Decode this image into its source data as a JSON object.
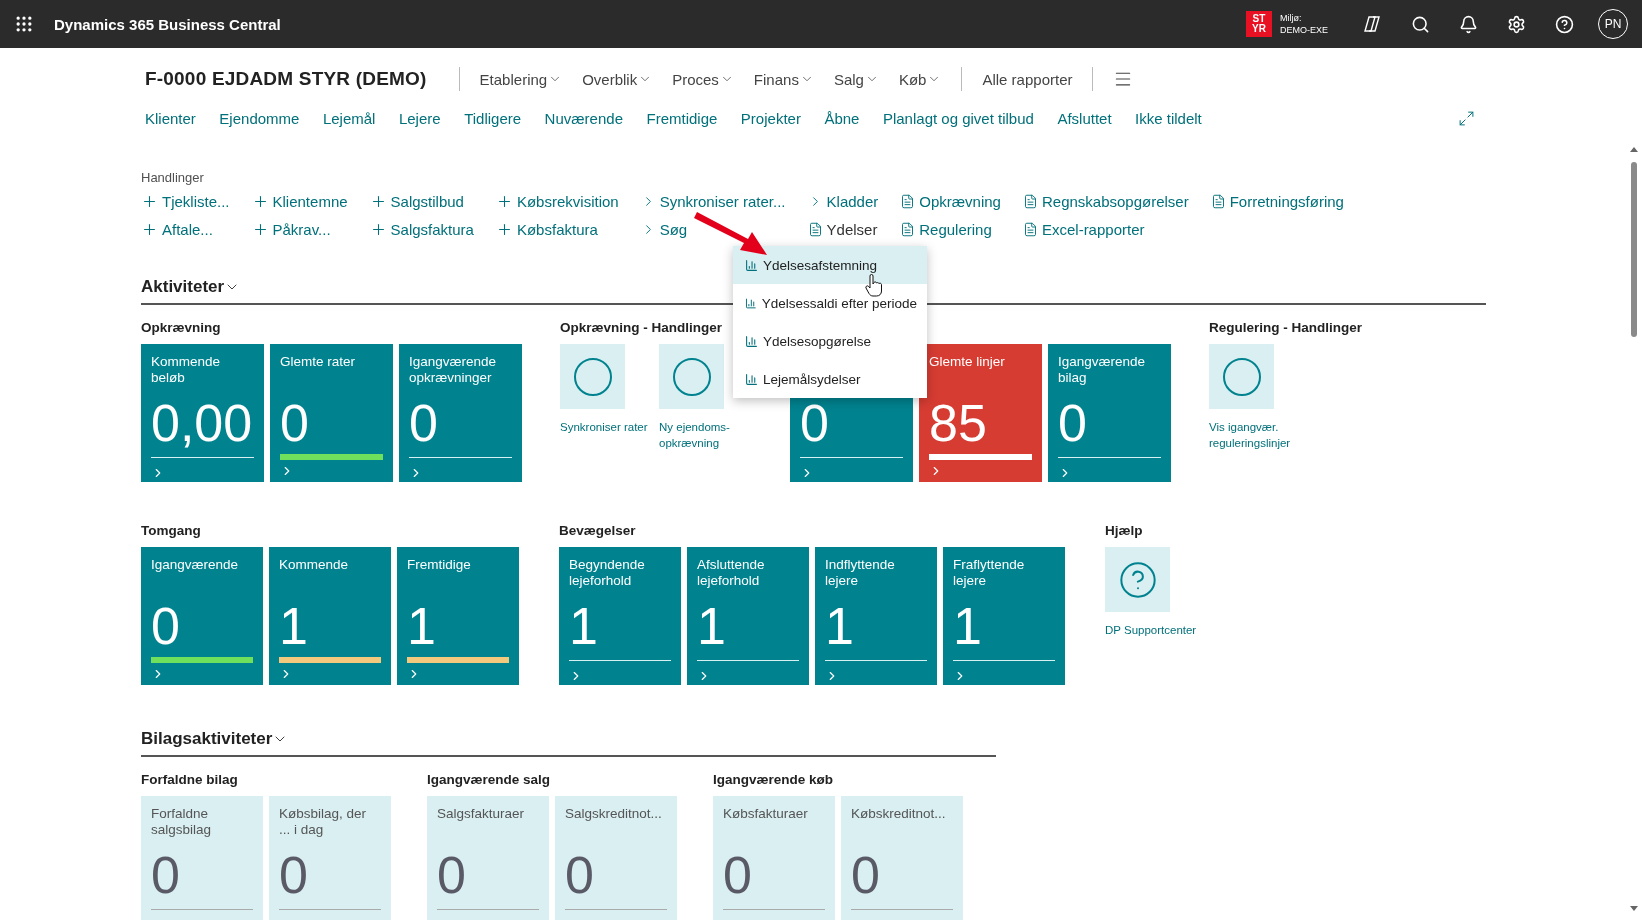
{
  "topbar": {
    "app_title": "Dynamics 365 Business Central",
    "env_badge": [
      "ST",
      "YR"
    ],
    "env_label": "Miljø:",
    "env_name": "DEMO-EXE",
    "avatar": "PN"
  },
  "header": {
    "company": "F-0000 EJDADM STYR (DEMO)",
    "menus": [
      {
        "label": "Etablering",
        "dropdown": true
      },
      {
        "label": "Overblik",
        "dropdown": true
      },
      {
        "label": "Proces",
        "dropdown": true
      },
      {
        "label": "Finans",
        "dropdown": true
      },
      {
        "label": "Salg",
        "dropdown": true
      },
      {
        "label": "Køb",
        "dropdown": true
      },
      {
        "label": "Alle rapporter",
        "dropdown": false
      }
    ],
    "links": [
      "Klienter",
      "Ejendomme",
      "Lejemål",
      "Lejere",
      "Tidligere",
      "Nuværende",
      "Fremtidige",
      "Projekter",
      "Åbne",
      "Planlagt og givet tilbud",
      "Afsluttet",
      "Ikke tildelt"
    ]
  },
  "actions": {
    "title": "Handlinger",
    "columns": [
      [
        {
          "kind": "plus",
          "label": "Tjekliste..."
        },
        {
          "kind": "plus",
          "label": "Aftale..."
        }
      ],
      [
        {
          "kind": "plus",
          "label": "Klientemne"
        },
        {
          "kind": "plus",
          "label": "Påkrav..."
        }
      ],
      [
        {
          "kind": "plus",
          "label": "Salgstilbud"
        },
        {
          "kind": "plus",
          "label": "Salgsfaktura"
        }
      ],
      [
        {
          "kind": "plus",
          "label": "Købsrekvisition"
        },
        {
          "kind": "plus",
          "label": "Købsfaktura"
        }
      ],
      [
        {
          "kind": "chevron",
          "label": "Synkroniser rater..."
        },
        {
          "kind": "chevron",
          "label": "Søg"
        }
      ],
      [
        {
          "kind": "chevron",
          "label": "Kladder"
        },
        {
          "kind": "report",
          "label": "Ydelser",
          "expanded": true
        }
      ],
      [
        {
          "kind": "report",
          "label": "Opkrævning"
        },
        {
          "kind": "report",
          "label": "Regulering"
        }
      ],
      [
        {
          "kind": "report",
          "label": "Regnskabsopgørelser"
        },
        {
          "kind": "report",
          "label": "Excel-rapporter"
        }
      ],
      [
        {
          "kind": "report",
          "label": "Forretningsføring"
        }
      ]
    ]
  },
  "dropdown": {
    "items": [
      {
        "label": "Ydelsesafstemning",
        "selected": true
      },
      {
        "label": "Ydelsessaldi efter periode",
        "selected": false
      },
      {
        "label": "Ydelsesopgørelse",
        "selected": false
      },
      {
        "label": "Lejemålsydelser",
        "selected": false
      }
    ]
  },
  "sections": [
    {
      "title": "Aktiviteter",
      "rows": [
        [
          {
            "title": "Opkrævning",
            "tiles": [
              {
                "kind": "tile",
                "title": "Kommende beløb",
                "value": "0,00",
                "alert": false
              },
              {
                "kind": "tile",
                "title": "Glemte rater",
                "value": "0",
                "alert": false,
                "color": "#6ee05c"
              },
              {
                "kind": "tile",
                "title": "Igangværende opkrævninger",
                "value": "0",
                "alert": false
              }
            ]
          },
          {
            "title": "Opkrævning - Handlinger",
            "tiles": [
              {
                "kind": "action",
                "label": "Synkroniser rater"
              },
              {
                "kind": "action",
                "label": "Ny ejendoms-opkrævning"
              }
            ]
          },
          {
            "tiles": [
              {
                "kind": "tile",
                "value": "0",
                "alert": false
              },
              {
                "kind": "tile",
                "title": "Glemte linjer",
                "value": "85",
                "alert": true,
                "color": "#ffffff"
              },
              {
                "kind": "tile",
                "title": "Igangværende bilag",
                "value": "0",
                "alert": false
              }
            ]
          },
          {
            "title": "Regulering - Handlinger",
            "tiles": [
              {
                "kind": "action",
                "label": "Vis igangvær. reguleringslinjer"
              }
            ]
          }
        ],
        [
          {
            "title": "Tomgang",
            "tiles": [
              {
                "kind": "tile",
                "title": "Igangværende",
                "value": "0",
                "alert": false,
                "color": "#6ee05c"
              },
              {
                "kind": "tile",
                "title": "Kommende",
                "value": "1",
                "alert": false,
                "color": "#f2c97d"
              },
              {
                "kind": "tile",
                "title": "Fremtidige",
                "value": "1",
                "alert": false,
                "color": "#f2c97d"
              }
            ]
          },
          {
            "title": "Bevægelser",
            "tiles": [
              {
                "kind": "tile",
                "title": "Begyndende lejeforhold",
                "value": "1",
                "alert": false
              },
              {
                "kind": "tile",
                "title": "Afsluttende lejeforhold",
                "value": "1",
                "alert": false
              },
              {
                "kind": "tile",
                "title": "Indflyttende lejere",
                "value": "1",
                "alert": false
              },
              {
                "kind": "tile",
                "title": "Fraflyttende lejere",
                "value": "1",
                "alert": false
              }
            ]
          },
          {
            "title": "Hjælp",
            "tiles": [
              {
                "kind": "help",
                "label": "DP Supportcenter"
              }
            ]
          }
        ]
      ]
    },
    {
      "title": "Bilagsaktiviteter",
      "rows": [
        [
          {
            "title": "Forfaldne bilag",
            "tiles": [
              {
                "kind": "light",
                "title": "Forfaldne salgsbilag",
                "value": "0"
              },
              {
                "kind": "light",
                "title": "Købsbilag, der ... i dag",
                "value": "0"
              }
            ]
          },
          {
            "title": "Igangværende salg",
            "tiles": [
              {
                "kind": "light",
                "title": "Salgsfakturaer",
                "value": "0"
              },
              {
                "kind": "light",
                "title": "Salgskreditnot...",
                "value": "0"
              }
            ]
          },
          {
            "title": "Igangværende køb",
            "tiles": [
              {
                "kind": "light",
                "title": "Købsfakturaer",
                "value": "0"
              },
              {
                "kind": "light",
                "title": "Købskreditnot...",
                "value": "0"
              }
            ]
          }
        ]
      ]
    }
  ]
}
